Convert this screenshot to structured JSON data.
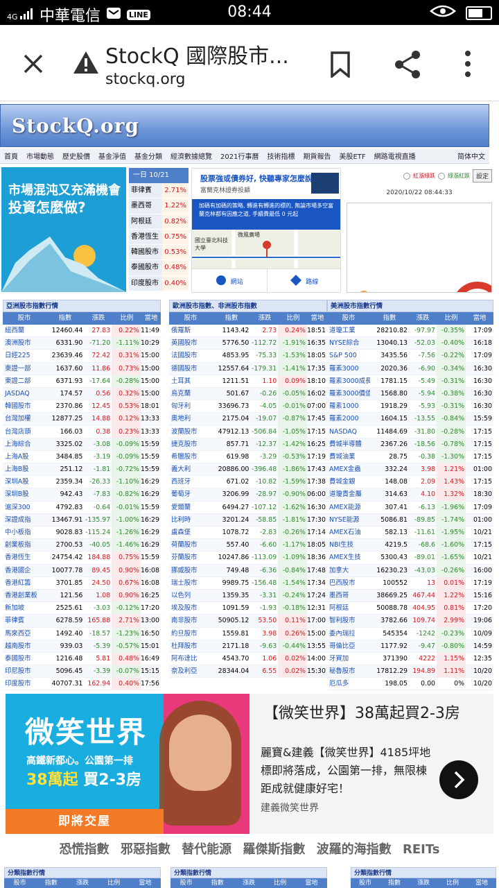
{
  "status_bar": {
    "carrier": "中華電信",
    "time": "08:44",
    "signal": "4G"
  },
  "browser": {
    "title": "StockQ 國際股市...",
    "url": "stockq.org"
  },
  "site": {
    "logo": "StockQ.org",
    "nav": [
      "首頁",
      "市場動態",
      "歷史股價",
      "基金淨值",
      "基金分類",
      "經濟數據總覽",
      "2021行事曆",
      "技術指標",
      "期貨報告",
      "美股ETF",
      "網路電視直播"
    ],
    "simplified": "简体中文"
  },
  "ad_left": {
    "line1": "市場混沌又充滿機會",
    "line2": "投資怎麼做?"
  },
  "mini_table": {
    "header_label": "一日",
    "header_date": "10/21",
    "rows": [
      {
        "name": "菲律賓",
        "pct": "2.71%"
      },
      {
        "name": "墨西哥",
        "pct": "1.22%"
      },
      {
        "name": "阿根廷",
        "pct": "0.82%"
      },
      {
        "name": "香港恆生",
        "pct": "0.75%"
      },
      {
        "name": "韓國股市",
        "pct": "0.53%"
      },
      {
        "name": "泰國股市",
        "pct": "0.48%"
      },
      {
        "name": "印度股市",
        "pct": "0.40%"
      }
    ]
  },
  "ad_mid": {
    "title": "股票強或債券好, 快聽專家怎麼說",
    "sub": "富蘭克林證券投顧",
    "blue": "加碼有加碼的策略, 轉進有轉進的標的, 無論市場多空富蘭克林都有因應之道, 手續費最低 0 元起",
    "map_label1": "微風廣場",
    "map_label2": "國立臺北科技大學",
    "btn_site": "網站",
    "btn_route": "路線"
  },
  "controls": {
    "red_label": "紅漲綠跌",
    "green_label": "綠漲紅跌",
    "set_button": "設定",
    "timestamp": "2020/10/22 08:44:33"
  },
  "tables": [
    {
      "caption": "亞洲股市指數行情",
      "headers": [
        "股市",
        "指數",
        "漲跌",
        "比例",
        "當地"
      ],
      "rows": [
        [
          "紐西蘭",
          "12460.44",
          "27.83",
          "0.22%",
          "11:49"
        ],
        [
          "澳洲股市",
          "6331.90",
          "-71.20",
          "-1.11%",
          "10:29"
        ],
        [
          "日經225",
          "23639.46",
          "72.42",
          "0.31%",
          "15:00"
        ],
        [
          "東證一部",
          "1637.60",
          "11.86",
          "0.73%",
          "15:00"
        ],
        [
          "東證二部",
          "6371.93",
          "-17.64",
          "-0.28%",
          "15:00"
        ],
        [
          "JASDAQ",
          "174.57",
          "0.56",
          "0.32%",
          "15:00"
        ],
        [
          "韓國股市",
          "2370.86",
          "12.45",
          "0.53%",
          "18:01"
        ],
        [
          "台灣加權",
          "12877.25",
          "14.88",
          "0.12%",
          "13:33"
        ],
        [
          "台灣店頭",
          "166.03",
          "0.38",
          "0.23%",
          "13:33"
        ],
        [
          "上海綜合",
          "3325.02",
          "-3.08",
          "-0.09%",
          "15:59"
        ],
        [
          "上海A股",
          "3484.85",
          "-3.19",
          "-0.09%",
          "15:59"
        ],
        [
          "上海B股",
          "251.12",
          "-1.81",
          "-0.72%",
          "15:59"
        ],
        [
          "深圳A股",
          "2359.34",
          "-26.33",
          "-1.10%",
          "16:29"
        ],
        [
          "深圳B股",
          "942.43",
          "-7.83",
          "-0.82%",
          "16:29"
        ],
        [
          "滬深300",
          "4792.83",
          "-0.64",
          "-0.01%",
          "15:59"
        ],
        [
          "深證成指",
          "13467.91",
          "-135.97",
          "-1.00%",
          "16:29"
        ],
        [
          "中小板指",
          "9028.83",
          "-115.24",
          "-1.26%",
          "16:29"
        ],
        [
          "創業板指",
          "2700.53",
          "-40.05",
          "-1.46%",
          "16:29"
        ],
        [
          "香港恆生",
          "24754.42",
          "184.88",
          "0.75%",
          "15:59"
        ],
        [
          "香港國企",
          "10077.78",
          "89.45",
          "0.90%",
          "16:08"
        ],
        [
          "香港紅籌",
          "3701.85",
          "24.50",
          "0.67%",
          "16:08"
        ],
        [
          "香港創業板",
          "121.56",
          "1.08",
          "0.90%",
          "16:25"
        ],
        [
          "新加坡",
          "2525.61",
          "-3.03",
          "-0.12%",
          "17:20"
        ],
        [
          "菲律賓",
          "6278.59",
          "165.88",
          "2.71%",
          "13:00"
        ],
        [
          "馬來西亞",
          "1492.40",
          "-18.57",
          "-1.23%",
          "16:50"
        ],
        [
          "越南股市",
          "939.03",
          "-5.39",
          "-0.57%",
          "15:01"
        ],
        [
          "泰國股市",
          "1216.48",
          "5.81",
          "0.48%",
          "16:49"
        ],
        [
          "印尼股市",
          "5096.45",
          "-3.39",
          "-0.07%",
          "15:15"
        ],
        [
          "印度股市",
          "40707.31",
          "162.94",
          "0.40%",
          "17:56"
        ]
      ]
    },
    {
      "caption": "歐洲股市指數、非洲股市指數",
      "headers": [
        "股市",
        "指數",
        "漲跌",
        "比例",
        "當地"
      ],
      "rows": [
        [
          "俄羅斯",
          "1143.42",
          "2.73",
          "0.24%",
          "18:51"
        ],
        [
          "英國股市",
          "5776.50",
          "-112.72",
          "-1.91%",
          "16:35"
        ],
        [
          "法國股市",
          "4853.95",
          "-75.33",
          "-1.53%",
          "18:05"
        ],
        [
          "德國股市",
          "12557.64",
          "-179.31",
          "-1.41%",
          "17:35"
        ],
        [
          "土耳其",
          "1211.51",
          "1.10",
          "0.09%",
          "18:10"
        ],
        [
          "烏克蘭",
          "501.67",
          "-0.26",
          "-0.05%",
          "16:02"
        ],
        [
          "匈牙利",
          "33696.73",
          "-4.05",
          "-0.01%",
          "07:00"
        ],
        [
          "奧地利",
          "2175.04",
          "-19.07",
          "-0.87%",
          "17:45"
        ],
        [
          "波蘭股市",
          "47912.13",
          "-506.84",
          "-1.05%",
          "17:15"
        ],
        [
          "捷克股市",
          "857.71",
          "-12.37",
          "-1.42%",
          "16:25"
        ],
        [
          "希臘股市",
          "619.98",
          "-3.29",
          "-0.53%",
          "17:19"
        ],
        [
          "義大利",
          "20886.00",
          "-396.48",
          "-1.86%",
          "17:43"
        ],
        [
          "西班牙",
          "671.02",
          "-10.82",
          "-1.59%",
          "17:38"
        ],
        [
          "葡萄牙",
          "3206.99",
          "-28.97",
          "-0.90%",
          "06:00"
        ],
        [
          "愛爾蘭",
          "6494.27",
          "-107.12",
          "-1.62%",
          "16:30"
        ],
        [
          "比利時",
          "3201.24",
          "-58.85",
          "-1.81%",
          "17:30"
        ],
        [
          "盧森堡",
          "1078.72",
          "-2.83",
          "-0.26%",
          "17:14"
        ],
        [
          "荷蘭股市",
          "557.40",
          "-6.60",
          "-1.17%",
          "18:05"
        ],
        [
          "芬蘭股市",
          "10247.86",
          "-113.09",
          "-1.09%",
          "18:36"
        ],
        [
          "挪威股市",
          "749.48",
          "-6.36",
          "-0.84%",
          "17:48"
        ],
        [
          "瑞士股市",
          "9989.75",
          "-156.48",
          "-1.54%",
          "17:34"
        ],
        [
          "以色列",
          "1359.35",
          "-3.31",
          "-0.24%",
          "17:24"
        ],
        [
          "埃及股市",
          "1091.59",
          "-1.93",
          "-0.18%",
          "12:31"
        ],
        [
          "南非股市",
          "50905.12",
          "53.50",
          "0.11%",
          "17:00"
        ],
        [
          "約旦股市",
          "1559.81",
          "3.98",
          "0.26%",
          "15:00"
        ],
        [
          "杜拜股市",
          "2171.18",
          "-9.63",
          "-0.44%",
          "13:55"
        ],
        [
          "阿布達比",
          "4543.70",
          "1.06",
          "0.02%",
          "14:00"
        ],
        [
          "奈及利亞",
          "28344.04",
          "6.55",
          "0.02%",
          "15:30"
        ]
      ]
    },
    {
      "caption": "美洲股市指數行情",
      "headers": [
        "股市",
        "指數",
        "漲跌",
        "比例",
        "當地"
      ],
      "rows": [
        [
          "道瓊工業",
          "28210.82",
          "-97.97",
          "-0.35%",
          "17:09"
        ],
        [
          "NYSE綜合",
          "13040.13",
          "-52.03",
          "-0.40%",
          "16:18"
        ],
        [
          "S&P 500",
          "3435.56",
          "-7.56",
          "-0.22%",
          "17:09"
        ],
        [
          "羅素3000",
          "2020.36",
          "-6.90",
          "-0.34%",
          "16:30"
        ],
        [
          "羅素3000成長",
          "1781.15",
          "-5.49",
          "-0.31%",
          "16:30"
        ],
        [
          "羅素3000價值",
          "1568.80",
          "-5.94",
          "-0.38%",
          "16:30"
        ],
        [
          "羅素1000",
          "1918.29",
          "-5.93",
          "-0.31%",
          "16:30"
        ],
        [
          "羅素2000",
          "1604.15",
          "-13.55",
          "-0.84%",
          "15:59"
        ],
        [
          "NASDAQ",
          "11484.69",
          "-31.80",
          "-0.28%",
          "17:15"
        ],
        [
          "費城半導體",
          "2367.26",
          "-18.56",
          "-0.78%",
          "17:15"
        ],
        [
          "費城油業",
          "28.75",
          "-0.38",
          "-1.30%",
          "17:15"
        ],
        [
          "AMEX金蟲",
          "332.24",
          "3.98",
          "1.21%",
          "01:00"
        ],
        [
          "費城金銀",
          "148.08",
          "2.09",
          "1.43%",
          "17:15"
        ],
        [
          "道瓊貴金屬",
          "314.63",
          "4.10",
          "1.32%",
          "18:30"
        ],
        [
          "AMEX能源",
          "307.41",
          "-6.13",
          "-1.96%",
          "17:09"
        ],
        [
          "NYSE能源",
          "5086.81",
          "-89.85",
          "-1.74%",
          "01:00"
        ],
        [
          "AMEX石油",
          "582.13",
          "-11.61",
          "-1.95%",
          "10/21"
        ],
        [
          "NBI生技",
          "4219.5",
          "-68.6",
          "-1.60%",
          "17:15"
        ],
        [
          "AMEX生技",
          "5300.43",
          "-89.01",
          "-1.65%",
          "10/21"
        ],
        [
          "加拿大",
          "16230.23",
          "-43.03",
          "-0.26%",
          "16:00"
        ],
        [
          "巴西股市",
          "100552",
          "13",
          "0.01%",
          "17:19"
        ],
        [
          "墨西哥",
          "38669.25",
          "467.44",
          "1.22%",
          "15:16"
        ],
        [
          "阿根廷",
          "50088.78",
          "404.95",
          "0.81%",
          "17:20"
        ],
        [
          "智利股市",
          "3782.66",
          "109.74",
          "2.99%",
          "19:06"
        ],
        [
          "委內瑞拉",
          "545354",
          "-1242",
          "-0.23%",
          "10/09"
        ],
        [
          "哥倫比亞",
          "1177.92",
          "-9.47",
          "-0.80%",
          "14:59"
        ],
        [
          "牙買加",
          "371390",
          "4222",
          "1.15%",
          "12:35"
        ],
        [
          "秘魯股市",
          "17812.29",
          "194.89",
          "1.11%",
          "10/20"
        ],
        [
          "厄瓜多",
          "198.05",
          "0.00",
          "0%",
          "10/20"
        ]
      ]
    }
  ],
  "ad_bottom": {
    "big": "微笑世界",
    "sub": "高鐵新都心。公園第一排",
    "price": "38萬起",
    "price2": "買2-3房",
    "bar": "即將交屋",
    "headline": "【微笑世界】38萬起買2-3房",
    "body": "麗寶&建義【微笑世界】4185坪地標即將落成，公園第一排，無限棟距成就健康好宅！",
    "source": "建義微笑世界"
  },
  "links": [
    "恐慌指數",
    "邪惡指數",
    "替代能源",
    "羅傑斯指數",
    "波羅的海指數",
    "REITs"
  ],
  "bottom_tables": [
    {
      "caption": "分類指數行情",
      "headers": [
        "股市",
        "指數",
        "漲跌",
        "比例",
        "當地"
      ]
    },
    {
      "caption": "分類指數行情",
      "headers": [
        "股市",
        "指數",
        "漲跌",
        "比例",
        "當地"
      ]
    },
    {
      "caption": "分類指數行情",
      "headers": [
        "股市",
        "指數",
        "漲跌",
        "比例",
        "當地"
      ]
    }
  ],
  "colors": {
    "up": "#d8161c",
    "down": "#2a8a2a",
    "header_blue": "#4f7fc9"
  }
}
